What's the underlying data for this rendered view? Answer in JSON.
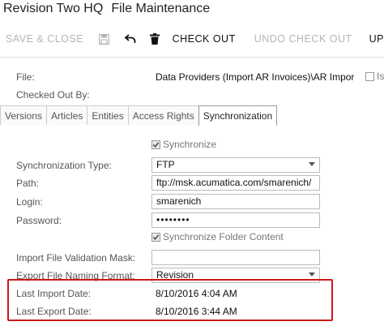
{
  "header": {
    "company": "Revision Two HQ",
    "screen_title": "File Maintenance"
  },
  "toolbar": {
    "save_close": "SAVE & CLOSE",
    "save_icon": "save-icon",
    "undo_icon": "undo-icon",
    "delete_icon": "delete-icon",
    "check_out": "CHECK OUT",
    "undo_check_out": "UNDO CHECK OUT",
    "more": "UP"
  },
  "summary": {
    "file_label": "File:",
    "file_value": "Data Providers (Import AR Invoices)\\AR Import II",
    "checked_out_by_label": "Checked Out By:",
    "is_label": "Is"
  },
  "tabs": [
    {
      "label": "Versions",
      "active": false
    },
    {
      "label": "Articles",
      "active": false
    },
    {
      "label": "Entities",
      "active": false
    },
    {
      "label": "Access Rights",
      "active": false
    },
    {
      "label": "Synchronization",
      "active": true
    }
  ],
  "sync": {
    "synchronize_label": "Synchronize",
    "synchronize_checked": true,
    "sync_type_label": "Synchronization Type:",
    "sync_type_value": "FTP",
    "path_label": "Path:",
    "path_value": "ftp://msk.acumatica.com/smarenich/",
    "login_label": "Login:",
    "login_value": "smarenich",
    "password_label": "Password:",
    "password_value": "••••••••",
    "sync_folder_label": "Synchronize Folder Content",
    "sync_folder_checked": true,
    "import_mask_label": "Import File Validation Mask:",
    "import_mask_value": "",
    "export_naming_label": "Export File Naming Format:",
    "export_naming_value": "Revision",
    "last_import_label": "Last Import Date:",
    "last_import_value": "8/10/2016 4:04 AM",
    "last_export_label": "Last Export Date:",
    "last_export_value": "8/10/2016 3:44 AM"
  },
  "colors": {
    "highlight": "#d01818",
    "disabled_text": "#b5b5b5"
  }
}
